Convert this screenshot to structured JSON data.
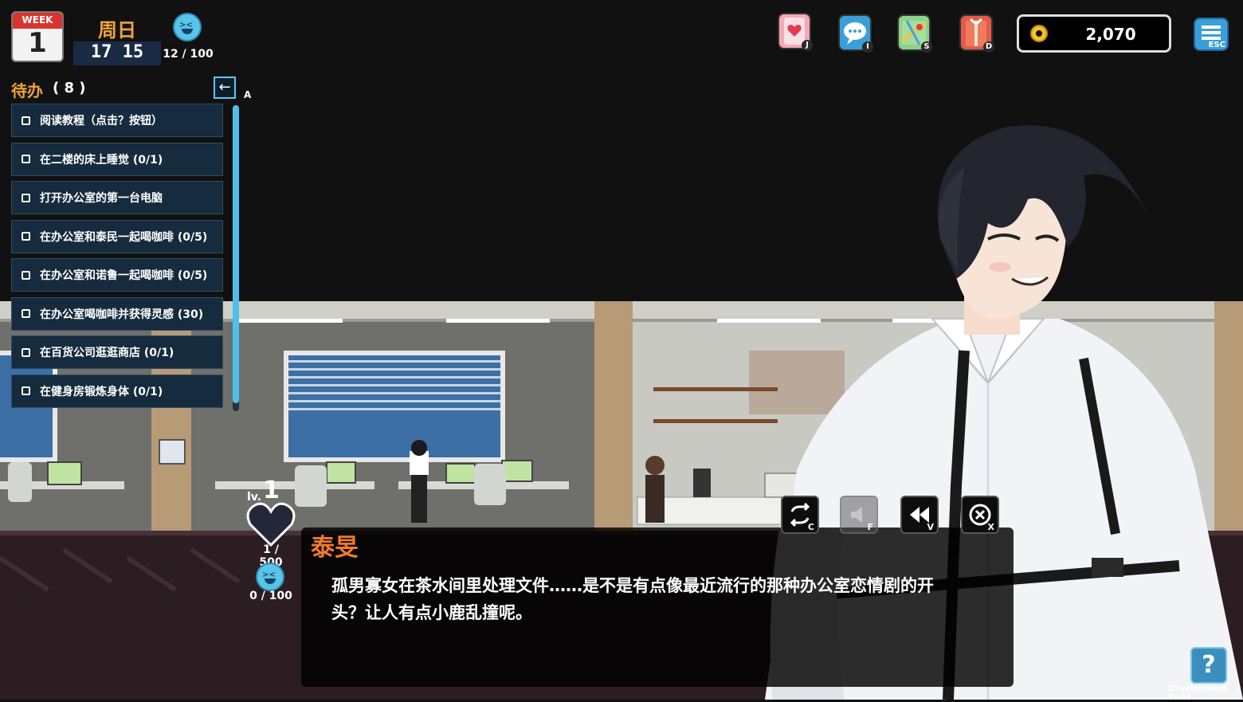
{
  "hud": {
    "calendar_week_label": "WEEK",
    "calendar_week_number": "1",
    "day_name": "周日",
    "time": "17 15",
    "mood_value": "12 / 100"
  },
  "todo": {
    "title": "待办",
    "count": "( 8 )",
    "collapse_key": "A",
    "items": [
      "阅读教程（点击？按钮）",
      "在二楼的床上睡觉 (0/1)",
      "打开办公室的第一台电脑",
      "在办公室和泰民一起喝咖啡 (0/5)",
      "在办公室和诺鲁一起喝咖啡 (0/5)",
      "在办公室喝咖啡并获得灵感 (30)",
      "在百货公司逛逛商店 (0/1)",
      "在健身房锻炼身体 (0/1)"
    ]
  },
  "top_icons": {
    "keys": [
      "J",
      "I",
      "S",
      "D"
    ],
    "money": "2,070",
    "esc_key": "ESC"
  },
  "character": {
    "level_label": "lv.",
    "level": "1",
    "affinity": "1 / 500",
    "mood": "0 / 100"
  },
  "dialog": {
    "speaker": "泰旻",
    "text": "孤男寡女在茶水间里处理文件……是不是有点像最近流行的那种办公室恋情剧的开头？让人有点小鹿乱撞呢。",
    "controls": [
      {
        "key": "C",
        "icon": "auto-repeat-icon"
      },
      {
        "key": "F",
        "icon": "speaker-icon"
      },
      {
        "key": "V",
        "icon": "rewind-icon"
      },
      {
        "key": "X",
        "icon": "close-circle-icon"
      }
    ]
  },
  "help": {
    "label": "?",
    "build": "Development Build"
  },
  "colors": {
    "accent_orange": "#f0a43a",
    "speaker_orange": "#f07a2b",
    "accent_blue": "#4fc0ee",
    "todo_bg": "#162b3e"
  }
}
